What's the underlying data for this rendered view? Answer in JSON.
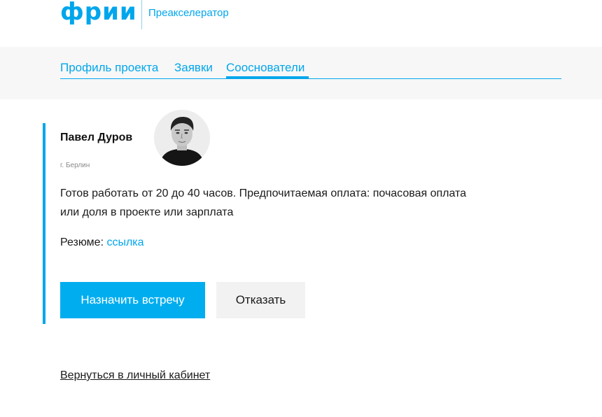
{
  "header": {
    "logo_text": "фрии",
    "subtitle": "Преакселератор",
    "brand_color": "#00a6ec"
  },
  "tabs": [
    {
      "label": "Профиль проекта",
      "active": false
    },
    {
      "label": "Заявки",
      "active": false
    },
    {
      "label": "Сооснователи",
      "active": true
    }
  ],
  "card": {
    "name": "Павел Дуров",
    "location": "г. Берлин",
    "description": "Готов работать от 20 до 40 часов. Предпочитаемая оплата: почасовая оплата или доля в проекте или зарплата",
    "resume_label": "Резюме:",
    "resume_link": "ссылка",
    "avatar_icon": "avatar-photo",
    "primary_button": "Назначить встречу",
    "secondary_button": "Отказать",
    "accent_color": "#00a6ec"
  },
  "footer": {
    "back_link": "Вернуться в личный кабинет"
  }
}
